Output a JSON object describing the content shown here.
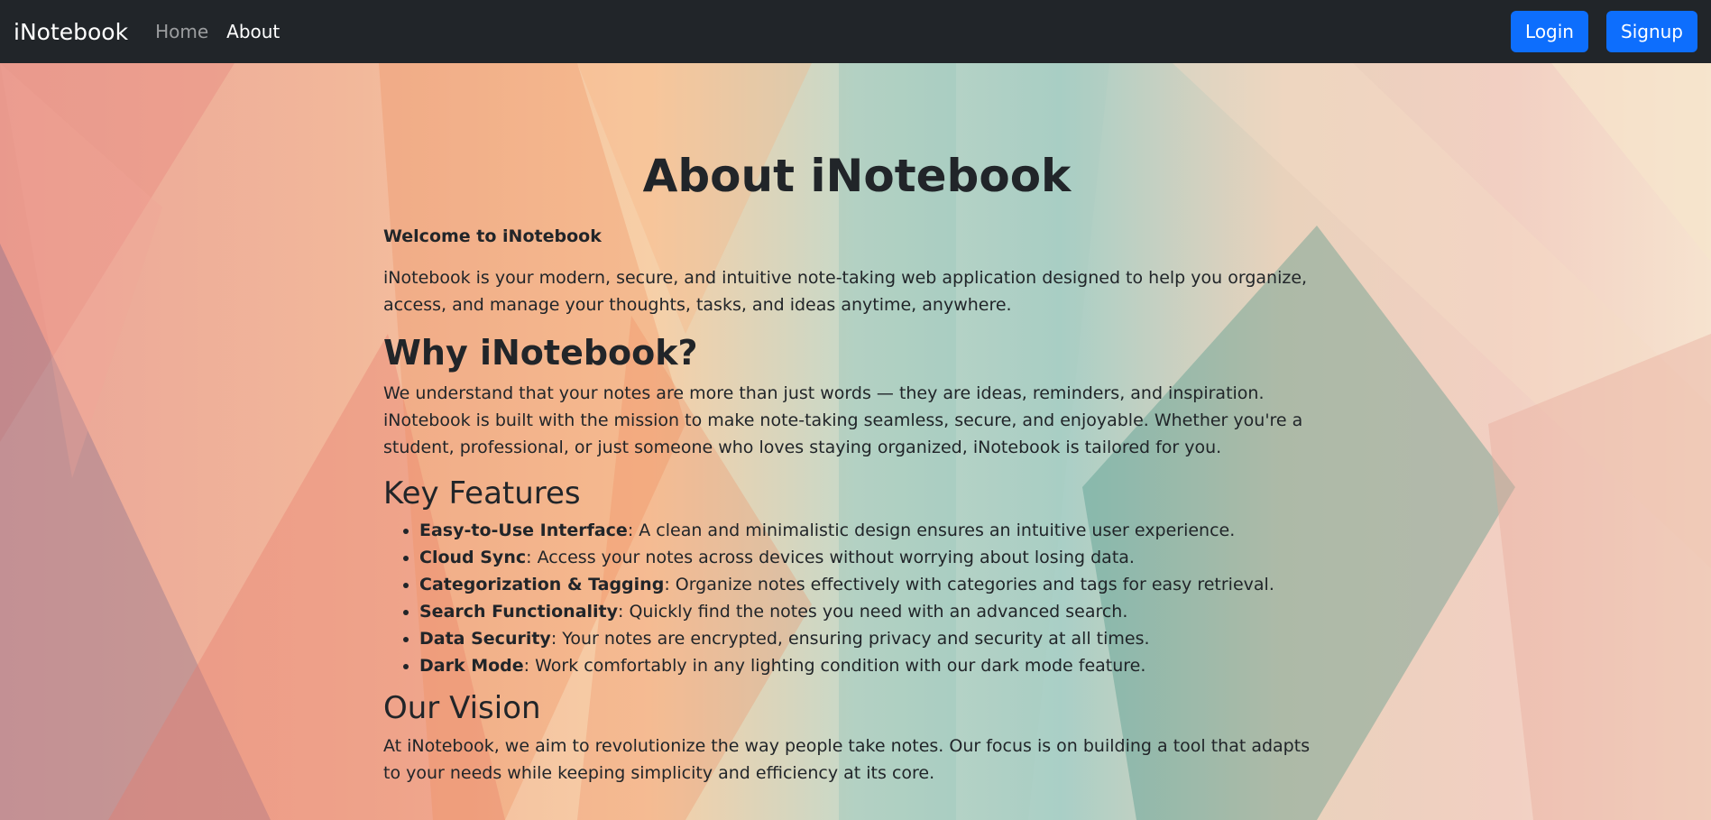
{
  "navbar": {
    "brand": "iNotebook",
    "links": [
      {
        "label": "Home",
        "active": false
      },
      {
        "label": "About",
        "active": true
      }
    ],
    "login_label": "Login",
    "signup_label": "Signup"
  },
  "page": {
    "title": "About iNotebook",
    "welcome_heading": "Welcome to iNotebook",
    "intro": "iNotebook is your modern, secure, and intuitive note-taking web application designed to help you organize, access, and manage your thoughts, tasks, and ideas anytime, anywhere.",
    "why_heading": "Why iNotebook?",
    "why_text": "We understand that your notes are more than just words — they are ideas, reminders, and inspiration. iNotebook is built with the mission to make note-taking seamless, secure, and enjoyable. Whether you're a student, professional, or just someone who loves staying organized, iNotebook is tailored for you.",
    "features_heading": "Key Features",
    "features": [
      {
        "name": "Easy-to-Use Interface",
        "desc": ": A clean and minimalistic design ensures an intuitive user experience."
      },
      {
        "name": "Cloud Sync",
        "desc": ": Access your notes across devices without worrying about losing data."
      },
      {
        "name": "Categorization & Tagging",
        "desc": ": Organize notes effectively with categories and tags for easy retrieval."
      },
      {
        "name": "Search Functionality",
        "desc": ": Quickly find the notes you need with an advanced search."
      },
      {
        "name": "Data Security",
        "desc": ": Your notes are encrypted, ensuring privacy and security at all times."
      },
      {
        "name": "Dark Mode",
        "desc": ": Work comfortably in any lighting condition with our dark mode feature."
      }
    ],
    "vision_heading": "Our Vision",
    "vision_text": "At iNotebook, we aim to revolutionize the way people take notes. Our focus is on building a tool that adapts to your needs while keeping simplicity and efficiency at its core."
  },
  "colors": {
    "navbar_bg": "#212529",
    "button_primary": "#0d6efd",
    "text": "#212529"
  }
}
